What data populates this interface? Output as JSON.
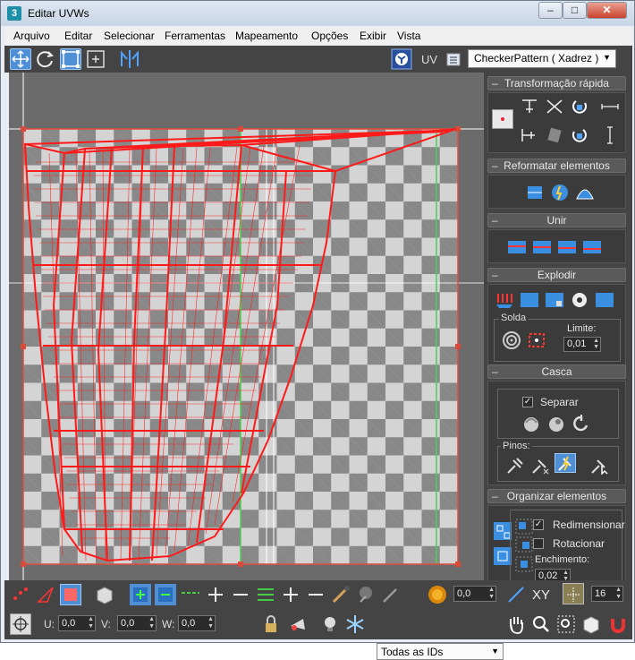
{
  "window": {
    "title": "Editar UVWs",
    "controls": {
      "minimize": "–",
      "maximize": "□",
      "close": "✕"
    }
  },
  "menu": [
    "Arquivo",
    "Editar",
    "Selecionar",
    "Ferramentas",
    "Mapeamento",
    "Opções",
    "Exibir",
    "Vista"
  ],
  "toolbar": {
    "icons": [
      "move-icon",
      "rotate-icon",
      "scale-icon",
      "freeform-icon",
      "mirror-icon",
      "checker-toggle-icon",
      "uv-icon",
      "list-icon"
    ],
    "uv_label": "UV",
    "texture_select": {
      "value": "CheckerPattern  ( Xadrez )"
    }
  },
  "rollouts": {
    "quick_transform": {
      "title": "Transformação rápida",
      "minus": "–"
    },
    "reshape": {
      "title": "Reformatar elementos",
      "minus": "–"
    },
    "stitch": {
      "title": "Unir",
      "minus": "–"
    },
    "explode": {
      "title": "Explodir",
      "minus": "–",
      "weld_label": "Solda",
      "limit_label": "Limite:",
      "limit_value": "0,01"
    },
    "peel": {
      "title": "Casca",
      "minus": "–",
      "detach_label": "Separar",
      "detach_checked": "✓",
      "pins_label": "Pinos:"
    },
    "arrange": {
      "title": "Organizar elementos",
      "minus": "–",
      "rescale_label": "Redimensionar",
      "rescale_checked": "✓",
      "rotate_label": "Rotacionar",
      "padding_label": "Enchimento:",
      "padding_value": "0,02"
    }
  },
  "bottombar": {
    "soft_select_value": "0,0",
    "xy_label": "XY",
    "grid_value": "16",
    "u_label": "U:",
    "u_value": "0,0",
    "v_label": "V:",
    "v_value": "0,0",
    "w_label": "W:",
    "w_value": "0,0",
    "ids_select": "Todas as IDs"
  },
  "colors": {
    "uv_wire": "#ff1a1a",
    "accent_blue": "#4f8fd6",
    "panel_bg": "#444444"
  }
}
